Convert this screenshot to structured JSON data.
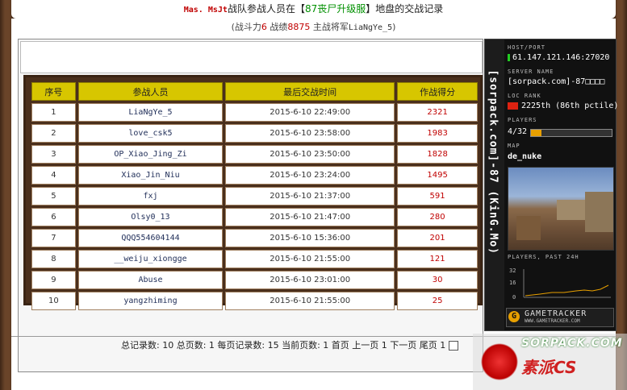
{
  "header": {
    "clan_name": "Mas. MsJt",
    "text_a": "战队参战人员在【",
    "server_name": "87丧尸升级服",
    "text_b": "】地盘的交战记录"
  },
  "subheader": {
    "power_label": "(战斗力",
    "power_value": "6",
    "record_label": " 战绩",
    "record_value": "8875",
    "leader_label": " 主战将军",
    "leader_value": "LiaNgYe_5",
    "close_paren": ")"
  },
  "table": {
    "headers": [
      "序号",
      "参战人员",
      "最后交战时间",
      "作战得分"
    ],
    "rows": [
      {
        "no": "1",
        "name": "LiaNgYe_5",
        "time": "2015-6-10 22:49:00",
        "score": "2321"
      },
      {
        "no": "2",
        "name": "love_csk5",
        "time": "2015-6-10 23:58:00",
        "score": "1983"
      },
      {
        "no": "3",
        "name": "OP_Xiao_Jing_Zi",
        "time": "2015-6-10 23:50:00",
        "score": "1828"
      },
      {
        "no": "4",
        "name": "Xiao_Jin_Niu",
        "time": "2015-6-10 23:24:00",
        "score": "1495"
      },
      {
        "no": "5",
        "name": "fxj",
        "time": "2015-6-10 21:37:00",
        "score": "591"
      },
      {
        "no": "6",
        "name": "Olsy0_13",
        "time": "2015-6-10 21:47:00",
        "score": "280"
      },
      {
        "no": "7",
        "name": "QQQ554604144",
        "time": "2015-6-10 15:36:00",
        "score": "201"
      },
      {
        "no": "8",
        "name": "__weiju_xiongge",
        "time": "2015-6-10 21:55:00",
        "score": "121"
      },
      {
        "no": "9",
        "name": "Abuse",
        "time": "2015-6-10 23:01:00",
        "score": "30"
      },
      {
        "no": "10",
        "name": "yangzhiming",
        "time": "2015-6-10 21:55:00",
        "score": "25"
      }
    ]
  },
  "pager": {
    "text": "总记录数: 10 总页数: 1 每页记录数: 15 当前页数: 1 首页 上一页 1 下一页 尾页 1"
  },
  "widget": {
    "vertical_text": "[sorpack.com]-87      (KinG.Mo)",
    "host_label": "HOST/PORT",
    "host_value": "61.147.121.146:27020",
    "server_label": "SERVER NAME",
    "server_value": "[sorpack.com]-87□□□□",
    "rank_label": "LOC  RANK",
    "rank_value": "2225th (86th pctile)",
    "players_label": "PLAYERS",
    "players_value": "4/32",
    "players_fraction": 0.125,
    "map_label": "MAP",
    "map_value": "de_nuke",
    "past_label": "PLAYERS, PAST 24H",
    "graph_ticks": [
      "32",
      "16",
      "0"
    ],
    "brand": "GAMETRACKER",
    "brand_url": "WWW.GAMETRACKER.COM"
  },
  "watermark": {
    "line1": "SORPACK.COM",
    "line2": "素派CS"
  }
}
